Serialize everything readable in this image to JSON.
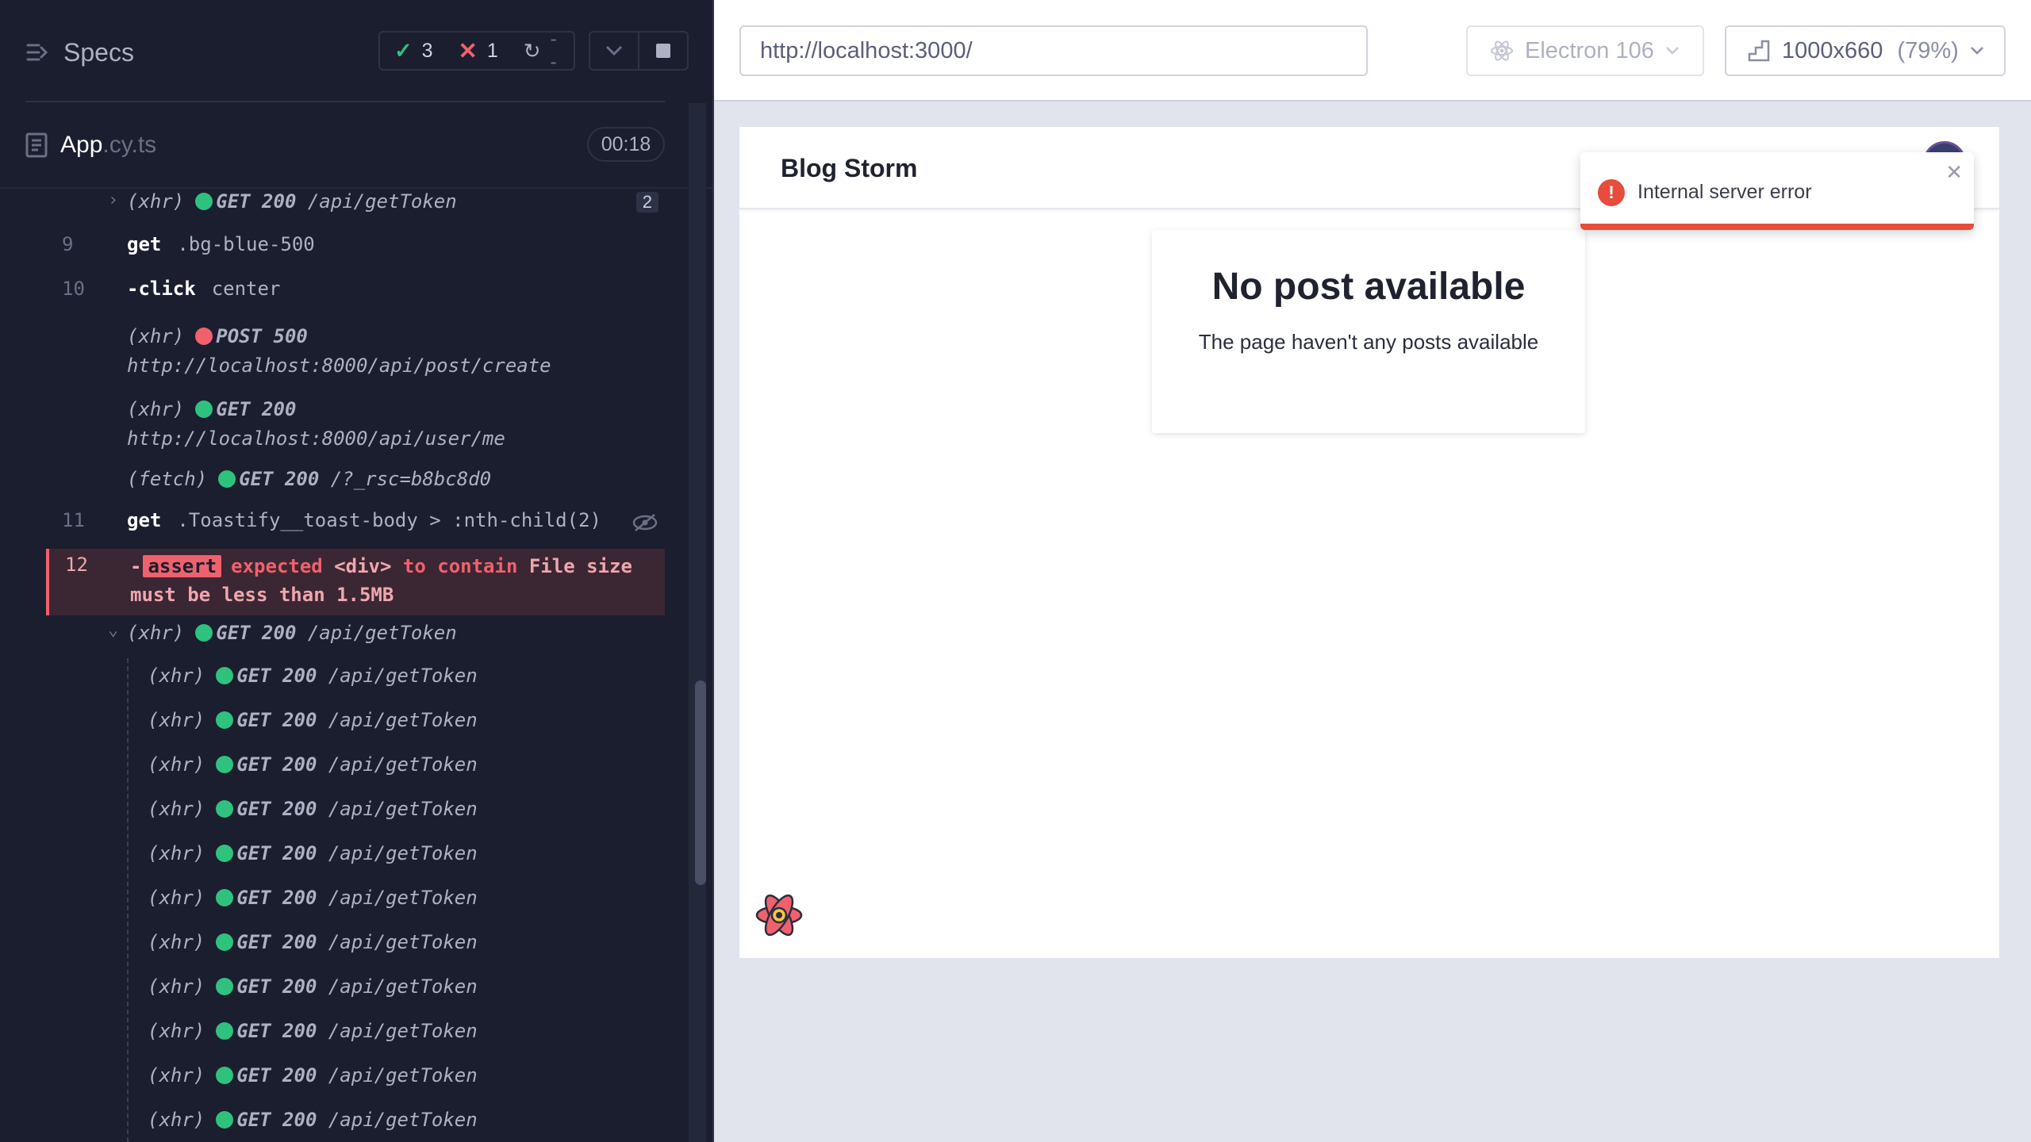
{
  "reporter": {
    "title": "Specs",
    "stats": {
      "passed": "3",
      "failed": "1",
      "pending": "--"
    },
    "spec_name": "App",
    "spec_ext": ".cy.ts",
    "duration": "00:18"
  },
  "log": {
    "group_header": {
      "type": "(xhr)",
      "method": "GET 200",
      "url": "/api/getToken",
      "count": "2"
    },
    "commands": [
      {
        "num": "9",
        "name": "get",
        "arg": ".bg-blue-500"
      },
      {
        "num": "10",
        "name": "-click",
        "arg": "center"
      }
    ],
    "requests_a": [
      {
        "type": "(xhr)",
        "method": "POST 500",
        "url": "http://localhost:8000/api/post/create",
        "status": "err"
      },
      {
        "type": "(xhr)",
        "method": "GET 200",
        "url": "http://localhost:8000/api/user/me",
        "status": "ok"
      },
      {
        "type": "(fetch)",
        "method": "GET 200",
        "url": "/?_rsc=b8bc8d0",
        "status": "ok"
      }
    ],
    "cmd11": {
      "num": "11",
      "name": "get",
      "arg": ".Toastify__toast-body > :nth-child(2)"
    },
    "assert": {
      "num": "12",
      "dash": "-",
      "tag": "assert",
      "expected": "expected",
      "subject": "<div>",
      "op": "to contain",
      "value_line1": "File size",
      "value_line2": "must be less than 1.5MB"
    },
    "group2": {
      "type": "(xhr)",
      "method": "GET 200",
      "url": "/api/getToken"
    },
    "token_rows": [
      {
        "type": "(xhr)",
        "method": "GET 200",
        "url": "/api/getToken"
      },
      {
        "type": "(xhr)",
        "method": "GET 200",
        "url": "/api/getToken"
      },
      {
        "type": "(xhr)",
        "method": "GET 200",
        "url": "/api/getToken"
      },
      {
        "type": "(xhr)",
        "method": "GET 200",
        "url": "/api/getToken"
      },
      {
        "type": "(xhr)",
        "method": "GET 200",
        "url": "/api/getToken"
      },
      {
        "type": "(xhr)",
        "method": "GET 200",
        "url": "/api/getToken"
      },
      {
        "type": "(xhr)",
        "method": "GET 200",
        "url": "/api/getToken"
      },
      {
        "type": "(xhr)",
        "method": "GET 200",
        "url": "/api/getToken"
      },
      {
        "type": "(xhr)",
        "method": "GET 200",
        "url": "/api/getToken"
      },
      {
        "type": "(xhr)",
        "method": "GET 200",
        "url": "/api/getToken"
      },
      {
        "type": "(xhr)",
        "method": "GET 200",
        "url": "/api/getToken"
      }
    ]
  },
  "aut": {
    "url": "http://localhost:3000/",
    "browser": "Electron 106",
    "viewport": "1000x660",
    "scale": "(79%)"
  },
  "app": {
    "title": "Blog Storm",
    "empty_title": "No post available",
    "empty_subtitle": "The page haven't any posts available",
    "toast_message": "Internal server error",
    "toast_progress": 1.0
  },
  "colors": {
    "pass": "#2ec27e",
    "fail": "#f0616e",
    "toast_error": "#e74c3c"
  }
}
